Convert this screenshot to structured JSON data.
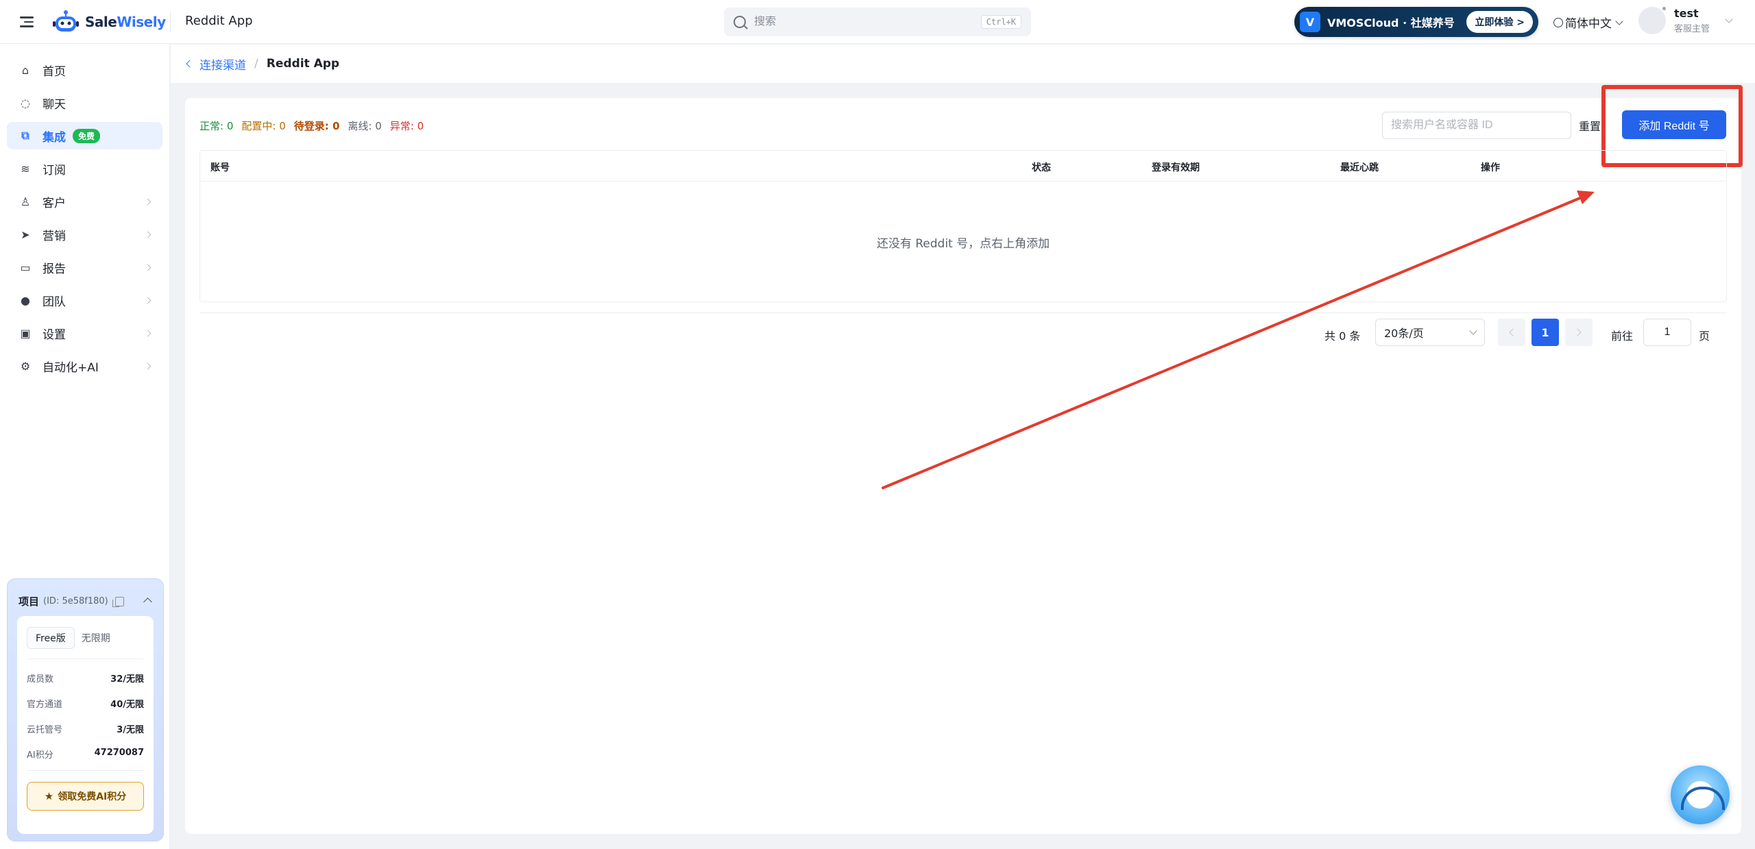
{
  "header": {
    "logo_text_a": "Sale",
    "logo_text_b": "Wisely",
    "app_title": "Reddit App",
    "search_placeholder": "搜索",
    "search_shortcut": "Ctrl+K",
    "promo_logo": "V",
    "promo_text": "VMOSCloud · 社媒养号",
    "promo_button": "立即体验 >",
    "language": "简体中文",
    "user_name": "test",
    "user_role": "客服主管"
  },
  "sidebar": {
    "items": [
      {
        "label": "首页",
        "icon": "home-icon"
      },
      {
        "label": "聊天",
        "icon": "chat-icon"
      },
      {
        "label": "集成",
        "icon": "integration-icon",
        "badge": "免费"
      },
      {
        "label": "订阅",
        "icon": "subscription-icon"
      },
      {
        "label": "客户",
        "icon": "customer-icon"
      },
      {
        "label": "营销",
        "icon": "marketing-icon"
      },
      {
        "label": "报告",
        "icon": "report-icon"
      },
      {
        "label": "团队",
        "icon": "team-icon"
      },
      {
        "label": "设置",
        "icon": "settings-icon"
      },
      {
        "label": "自动化+AI",
        "icon": "automation-icon"
      }
    ],
    "project": {
      "title": "项目",
      "id": "(ID: 5e58f180)",
      "plan": "Free版",
      "term": "无限期",
      "stats": [
        {
          "label": "成员数",
          "value": "32/无限"
        },
        {
          "label": "官方通道",
          "value": "40/无限"
        },
        {
          "label": "云托管号",
          "value": "3/无限"
        },
        {
          "label": "AI积分",
          "value": "47270087"
        }
      ],
      "claim_button": "领取免费AI积分"
    }
  },
  "breadcrumb": {
    "parent": "连接渠道",
    "current": "Reddit App"
  },
  "main": {
    "status": {
      "normal": "正常: 0",
      "configuring": "配置中: 0",
      "pending": "待登录: 0",
      "offline": "离线: 0",
      "error": "异常: 0"
    },
    "filter_placeholder": "搜索用户名或容器 ID",
    "reset_label": "重置",
    "add_button": "添加 Reddit 号",
    "table": {
      "columns": [
        "账号",
        "状态",
        "登录有效期",
        "最近心跳",
        "操作"
      ],
      "empty_text": "还没有 Reddit 号，点右上角添加"
    },
    "pagination": {
      "total": "共 0 条",
      "page_size": "20条/页",
      "current_page": "1",
      "goto_label": "前往",
      "goto_value": "1",
      "page_unit": "页"
    }
  },
  "colors": {
    "primary": "#2563eb",
    "annotation_red": "#e63a2e"
  }
}
